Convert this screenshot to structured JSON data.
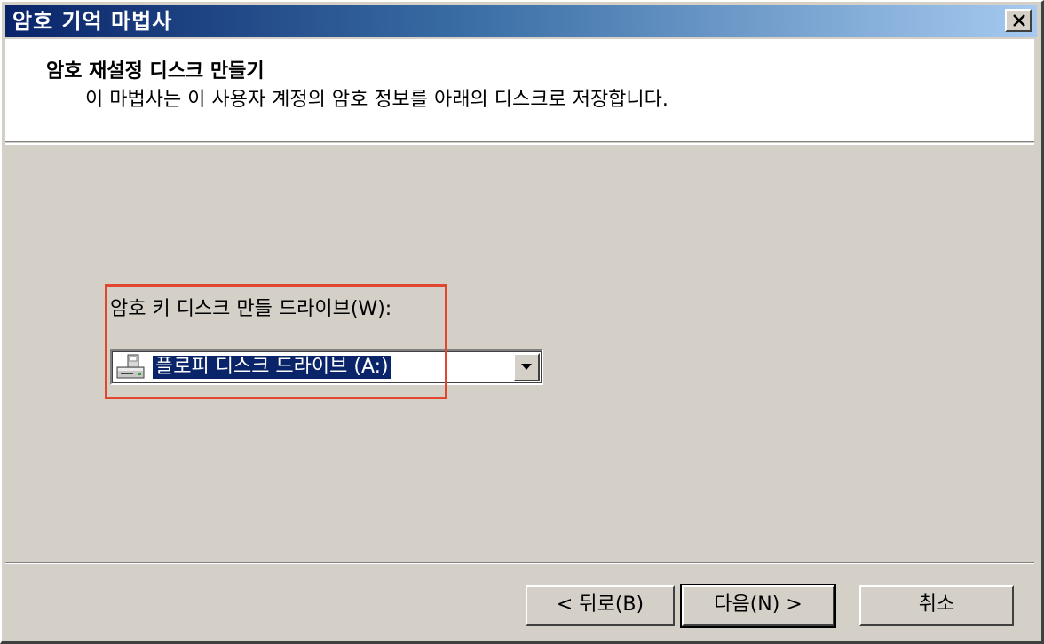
{
  "window": {
    "title": "암호 기억 마법사"
  },
  "header": {
    "title": "암호 재설정 디스크 만들기",
    "subtitle": "이 마법사는 이 사용자 계정의 암호 정보를 아래의 디스크로 저장합니다."
  },
  "drive_select": {
    "label": "암호 키 디스크 만들 드라이브(W):",
    "selected": "플로피 디스크 드라이브 (A:)",
    "icon": "floppy-drive-icon"
  },
  "buttons": {
    "back": "< 뒤로(B)",
    "next": "다음(N) >",
    "cancel": "취소"
  },
  "colors": {
    "titlebar_start": "#0a246a",
    "titlebar_end": "#a6caf0",
    "highlight_box": "#e0472e",
    "dialog_bg": "#d4d0c8"
  }
}
